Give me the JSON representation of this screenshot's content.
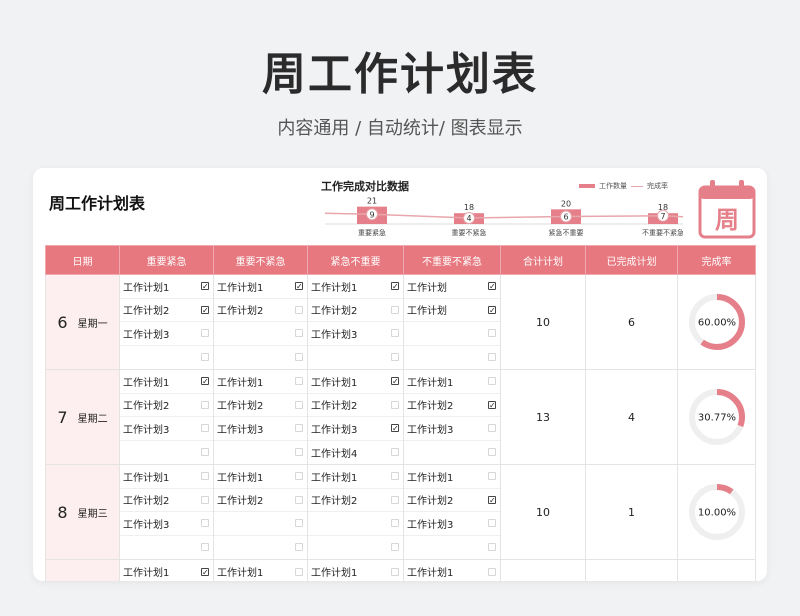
{
  "hero": {
    "title": "周工作计划表",
    "subtitle": "内容通用 / 自动统计/ 图表显示"
  },
  "sheet": {
    "title": "周工作计划表"
  },
  "chart_data": {
    "type": "bar",
    "title": "工作完成对比数据",
    "categories": [
      "重要紧急",
      "重要不紧急",
      "紧急不重要",
      "不重要不紧急"
    ],
    "series": [
      {
        "name": "工作数量",
        "values": [
          21,
          18,
          20,
          18
        ]
      },
      {
        "name": "完成率",
        "values": [
          9,
          4,
          6,
          7
        ]
      }
    ],
    "ylim": [
      0,
      21
    ],
    "colors": {
      "bar": "#e57f89",
      "line": "#e8a6ad"
    },
    "legend": "top-right"
  },
  "calendar_icon": {
    "char": "周",
    "color": "#e57f89"
  },
  "table": {
    "headers": [
      "日期",
      "重要紧急",
      "重要不紧急",
      "紧急不重要",
      "不重要不紧急",
      "合计计划",
      "已完成计划",
      "完成率"
    ],
    "rows": [
      {
        "day": "6",
        "weekday": "星期一",
        "cols": [
          [
            {
              "t": "工作计划1",
              "c": true
            },
            {
              "t": "工作计划2",
              "c": true
            },
            {
              "t": "工作计划3",
              "c": false
            },
            {
              "t": "",
              "c": false
            }
          ],
          [
            {
              "t": "工作计划1",
              "c": true
            },
            {
              "t": "工作计划2",
              "c": false
            },
            {
              "t": "",
              "c": false
            },
            {
              "t": "",
              "c": false
            }
          ],
          [
            {
              "t": "工作计划1",
              "c": true
            },
            {
              "t": "工作计划2",
              "c": false
            },
            {
              "t": "工作计划3",
              "c": false
            },
            {
              "t": "",
              "c": false
            }
          ],
          [
            {
              "t": "工作计划",
              "c": true
            },
            {
              "t": "工作计划",
              "c": true
            },
            {
              "t": "",
              "c": false
            },
            {
              "t": "",
              "c": false
            }
          ]
        ],
        "total": "10",
        "done": "6",
        "rate": "60.00%",
        "rate_value": 0.6
      },
      {
        "day": "7",
        "weekday": "星期二",
        "cols": [
          [
            {
              "t": "工作计划1",
              "c": true
            },
            {
              "t": "工作计划2",
              "c": false
            },
            {
              "t": "工作计划3",
              "c": false
            },
            {
              "t": "",
              "c": false
            }
          ],
          [
            {
              "t": "工作计划1",
              "c": false
            },
            {
              "t": "工作计划2",
              "c": false
            },
            {
              "t": "工作计划3",
              "c": false
            },
            {
              "t": "",
              "c": false
            }
          ],
          [
            {
              "t": "工作计划1",
              "c": true
            },
            {
              "t": "工作计划2",
              "c": false
            },
            {
              "t": "工作计划3",
              "c": true
            },
            {
              "t": "工作计划4",
              "c": false
            }
          ],
          [
            {
              "t": "工作计划1",
              "c": false
            },
            {
              "t": "工作计划2",
              "c": true
            },
            {
              "t": "工作计划3",
              "c": false
            },
            {
              "t": "",
              "c": false
            }
          ]
        ],
        "total": "13",
        "done": "4",
        "rate": "30.77%",
        "rate_value": 0.3077
      },
      {
        "day": "8",
        "weekday": "星期三",
        "cols": [
          [
            {
              "t": "工作计划1",
              "c": false
            },
            {
              "t": "工作计划2",
              "c": false
            },
            {
              "t": "工作计划3",
              "c": false
            },
            {
              "t": "",
              "c": false
            }
          ],
          [
            {
              "t": "工作计划1",
              "c": false
            },
            {
              "t": "工作计划2",
              "c": false
            },
            {
              "t": "",
              "c": false
            },
            {
              "t": "",
              "c": false
            }
          ],
          [
            {
              "t": "工作计划1",
              "c": false
            },
            {
              "t": "工作计划2",
              "c": false
            },
            {
              "t": "",
              "c": false
            },
            {
              "t": "",
              "c": false
            }
          ],
          [
            {
              "t": "工作计划1",
              "c": false
            },
            {
              "t": "工作计划2",
              "c": true
            },
            {
              "t": "工作计划3",
              "c": false
            },
            {
              "t": "",
              "c": false
            }
          ]
        ],
        "total": "10",
        "done": "1",
        "rate": "10.00%",
        "rate_value": 0.1
      },
      {
        "day": "",
        "weekday": "",
        "cols": [
          [
            {
              "t": "工作计划1",
              "c": true
            }
          ],
          [
            {
              "t": "工作计划1",
              "c": false
            }
          ],
          [
            {
              "t": "工作计划1",
              "c": false
            }
          ],
          [
            {
              "t": "工作计划1",
              "c": false
            }
          ]
        ],
        "total": "",
        "done": "",
        "rate": "",
        "rate_value": null
      }
    ]
  }
}
